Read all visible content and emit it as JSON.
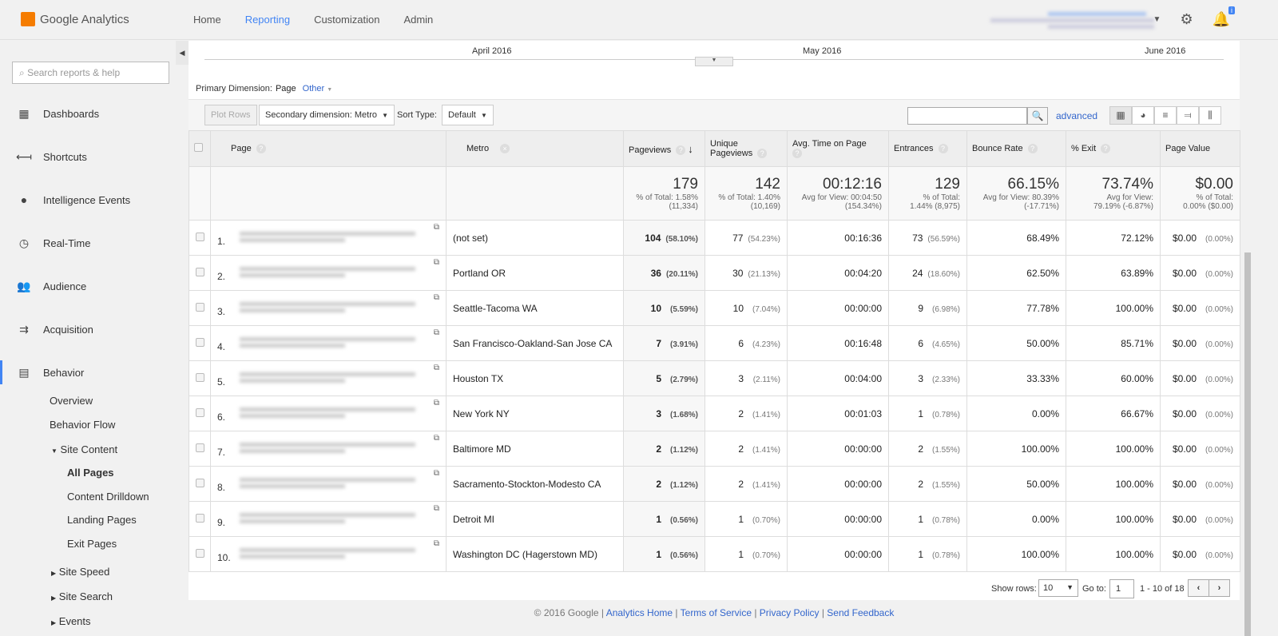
{
  "header": {
    "app_name": "Google Analytics",
    "nav": [
      "Home",
      "Reporting",
      "Customization",
      "Admin"
    ],
    "active_nav": "Reporting",
    "notification_badge": "i"
  },
  "sidebar": {
    "search_placeholder": "Search reports & help",
    "items": [
      {
        "label": "Dashboards",
        "icon": "grid-icon"
      },
      {
        "label": "Shortcuts",
        "icon": "shortcut-arrow-icon"
      },
      {
        "label": "Intelligence Events",
        "icon": "lightbulb-icon"
      },
      {
        "label": "Real-Time",
        "icon": "clock-icon"
      },
      {
        "label": "Audience",
        "icon": "people-icon"
      },
      {
        "label": "Acquisition",
        "icon": "acquisition-arrows-icon"
      },
      {
        "label": "Behavior",
        "icon": "behavior-icon"
      }
    ],
    "behavior_sub": [
      "Overview",
      "Behavior Flow",
      "Site Content",
      "All Pages",
      "Content Drilldown",
      "Landing Pages",
      "Exit Pages",
      "Site Speed",
      "Site Search",
      "Events"
    ]
  },
  "timeline": {
    "labels": [
      "April 2016",
      "May 2016",
      "June 2016"
    ]
  },
  "dimension": {
    "label": "Primary Dimension:",
    "primary": "Page",
    "other": "Other"
  },
  "toolbar": {
    "plot_rows": "Plot Rows",
    "secondary": "Secondary dimension: Metro",
    "sort_label": "Sort Type:",
    "sort_value": "Default",
    "search_value": "",
    "advanced": "advanced"
  },
  "table": {
    "headers": {
      "page": "Page",
      "metro": "Metro",
      "pageviews": "Pageviews",
      "unique": "Unique Pageviews",
      "avg_time": "Avg. Time on Page",
      "entrances": "Entrances",
      "bounce": "Bounce Rate",
      "exit": "% Exit",
      "value": "Page Value"
    },
    "totals": {
      "pageviews": {
        "value": "179",
        "sub1": "% of Total: 1.58%",
        "sub2": "(11,334)"
      },
      "unique": {
        "value": "142",
        "sub1": "% of Total: 1.40%",
        "sub2": "(10,169)"
      },
      "avg_time": {
        "value": "00:12:16",
        "sub1": "Avg for View: 00:04:50",
        "sub2": "(154.34%)"
      },
      "entrances": {
        "value": "129",
        "sub1": "% of Total:",
        "sub2": "1.44% (8,975)"
      },
      "bounce": {
        "value": "66.15%",
        "sub1": "Avg for View: 80.39%",
        "sub2": "(-17.71%)"
      },
      "exit": {
        "value": "73.74%",
        "sub1": "Avg for View:",
        "sub2": "79.19% (-6.87%)"
      },
      "value": {
        "value": "$0.00",
        "sub1": "% of Total:",
        "sub2": "0.00% ($0.00)"
      }
    },
    "rows": [
      {
        "n": "1.",
        "metro": "(not set)",
        "pv": "104",
        "pvp": "(58.10%)",
        "up": "77",
        "upp": "(54.23%)",
        "t": "00:16:36",
        "e": "73",
        "ep": "(56.59%)",
        "b": "68.49%",
        "x": "72.12%",
        "v": "$0.00",
        "vp": "(0.00%)"
      },
      {
        "n": "2.",
        "metro": "Portland OR",
        "pv": "36",
        "pvp": "(20.11%)",
        "up": "30",
        "upp": "(21.13%)",
        "t": "00:04:20",
        "e": "24",
        "ep": "(18.60%)",
        "b": "62.50%",
        "x": "63.89%",
        "v": "$0.00",
        "vp": "(0.00%)"
      },
      {
        "n": "3.",
        "metro": "Seattle-Tacoma WA",
        "pv": "10",
        "pvp": "(5.59%)",
        "up": "10",
        "upp": "(7.04%)",
        "t": "00:00:00",
        "e": "9",
        "ep": "(6.98%)",
        "b": "77.78%",
        "x": "100.00%",
        "v": "$0.00",
        "vp": "(0.00%)"
      },
      {
        "n": "4.",
        "metro": "San Francisco-Oakland-San Jose CA",
        "pv": "7",
        "pvp": "(3.91%)",
        "up": "6",
        "upp": "(4.23%)",
        "t": "00:16:48",
        "e": "6",
        "ep": "(4.65%)",
        "b": "50.00%",
        "x": "85.71%",
        "v": "$0.00",
        "vp": "(0.00%)"
      },
      {
        "n": "5.",
        "metro": "Houston TX",
        "pv": "5",
        "pvp": "(2.79%)",
        "up": "3",
        "upp": "(2.11%)",
        "t": "00:04:00",
        "e": "3",
        "ep": "(2.33%)",
        "b": "33.33%",
        "x": "60.00%",
        "v": "$0.00",
        "vp": "(0.00%)"
      },
      {
        "n": "6.",
        "metro": "New York NY",
        "pv": "3",
        "pvp": "(1.68%)",
        "up": "2",
        "upp": "(1.41%)",
        "t": "00:01:03",
        "e": "1",
        "ep": "(0.78%)",
        "b": "0.00%",
        "x": "66.67%",
        "v": "$0.00",
        "vp": "(0.00%)"
      },
      {
        "n": "7.",
        "metro": "Baltimore MD",
        "pv": "2",
        "pvp": "(1.12%)",
        "up": "2",
        "upp": "(1.41%)",
        "t": "00:00:00",
        "e": "2",
        "ep": "(1.55%)",
        "b": "100.00%",
        "x": "100.00%",
        "v": "$0.00",
        "vp": "(0.00%)"
      },
      {
        "n": "8.",
        "metro": "Sacramento-Stockton-Modesto CA",
        "pv": "2",
        "pvp": "(1.12%)",
        "up": "2",
        "upp": "(1.41%)",
        "t": "00:00:00",
        "e": "2",
        "ep": "(1.55%)",
        "b": "50.00%",
        "x": "100.00%",
        "v": "$0.00",
        "vp": "(0.00%)"
      },
      {
        "n": "9.",
        "metro": "Detroit MI",
        "pv": "1",
        "pvp": "(0.56%)",
        "up": "1",
        "upp": "(0.70%)",
        "t": "00:00:00",
        "e": "1",
        "ep": "(0.78%)",
        "b": "0.00%",
        "x": "100.00%",
        "v": "$0.00",
        "vp": "(0.00%)"
      },
      {
        "n": "10.",
        "metro": "Washington DC (Hagerstown MD)",
        "pv": "1",
        "pvp": "(0.56%)",
        "up": "1",
        "upp": "(0.70%)",
        "t": "00:00:00",
        "e": "1",
        "ep": "(0.78%)",
        "b": "100.00%",
        "x": "100.00%",
        "v": "$0.00",
        "vp": "(0.00%)"
      }
    ]
  },
  "pager": {
    "show_rows_label": "Show rows:",
    "show_rows": "10",
    "goto_label": "Go to:",
    "goto": "1",
    "range": "1 - 10 of 18"
  },
  "footer": {
    "copyright": "© 2016 Google",
    "links": [
      "Analytics Home",
      "Terms of Service",
      "Privacy Policy",
      "Send Feedback"
    ]
  },
  "colors": {
    "accent": "#4285f4",
    "link": "#3366cc",
    "logo": "#f57c00"
  }
}
